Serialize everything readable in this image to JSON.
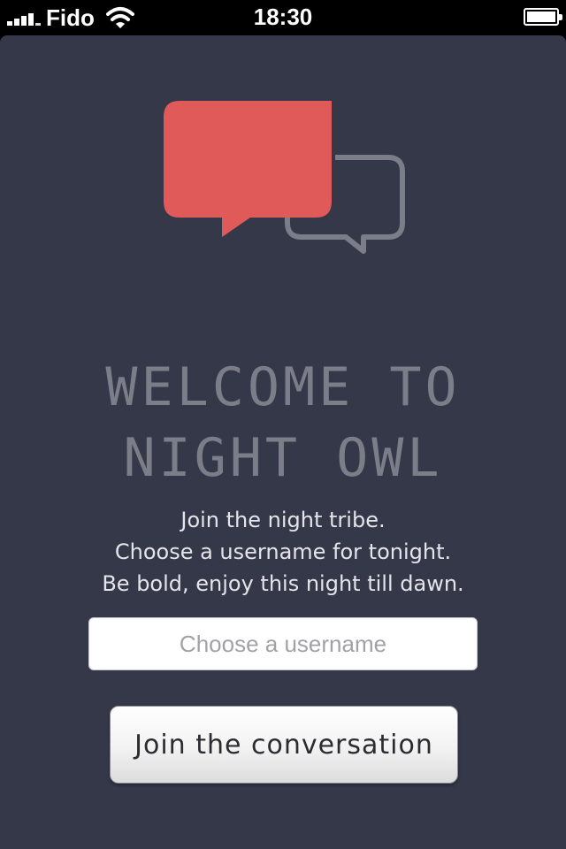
{
  "status_bar": {
    "carrier": "Fido",
    "time": "18:30",
    "signal_bars": 4,
    "battery_level": 1.0
  },
  "logo": {
    "icon": "chat-bubbles-icon",
    "colors": {
      "primary_bubble": "#e05a5a",
      "outline_bubble": "#7b7e88"
    }
  },
  "welcome": {
    "title_line1": "WELCOME TO",
    "title_line2": "NIGHT OWL",
    "tagline": [
      "Join the night tribe.",
      "Choose a username for tonight.",
      "Be bold, enjoy this night till dawn."
    ]
  },
  "form": {
    "username_placeholder": "Choose a username",
    "username_value": "",
    "join_label": "Join the conversation"
  },
  "colors": {
    "background": "#353848",
    "title_text": "#7b7e88",
    "tagline_text": "#e4e4ea"
  }
}
